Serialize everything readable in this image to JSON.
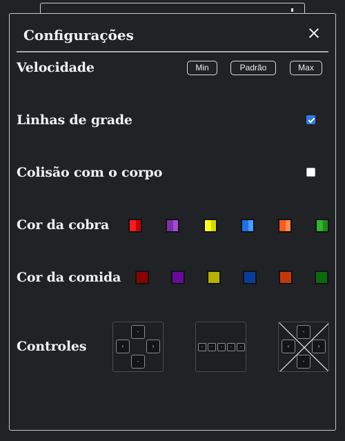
{
  "panel": {
    "title": "Configurações",
    "close_icon": "close-icon"
  },
  "speed": {
    "label": "Velocidade",
    "options": [
      "Min",
      "Padrão",
      "Max"
    ]
  },
  "grid_lines": {
    "label": "Linhas de grade",
    "checked": true
  },
  "body_collision": {
    "label": "Colisão com o corpo",
    "checked": false
  },
  "snake_color": {
    "label": "Cor da cobra",
    "swatches": [
      {
        "name": "red",
        "main": "#ff1a1a",
        "shade": "#c40000"
      },
      {
        "name": "purple",
        "main": "#7d2ea8",
        "shade": "#a24bd6"
      },
      {
        "name": "yellow",
        "main": "#ffff1a",
        "shade": "#d9d900"
      },
      {
        "name": "blue",
        "main": "#1e6fe8",
        "shade": "#4a9bff"
      },
      {
        "name": "orange",
        "main": "#ff5a1a",
        "shade": "#ff8a4a"
      },
      {
        "name": "green",
        "main": "#2fb52f",
        "shade": "#1f8a1f"
      }
    ]
  },
  "food_color": {
    "label": "Cor da comida",
    "swatches": [
      {
        "name": "dark-red",
        "main": "#8b0000"
      },
      {
        "name": "dark-purple",
        "main": "#6a0a9a"
      },
      {
        "name": "olive",
        "main": "#b3b300"
      },
      {
        "name": "dark-blue",
        "main": "#0a3d9a"
      },
      {
        "name": "rust",
        "main": "#c2380a"
      },
      {
        "name": "dark-green",
        "main": "#0b6a0b"
      }
    ]
  },
  "controls": {
    "label": "Controles",
    "options": [
      {
        "name": "dpad",
        "keys": [
          "-",
          "‹",
          "›",
          "-"
        ]
      },
      {
        "name": "row",
        "keys": [
          "-",
          "-",
          "-",
          "-",
          "-"
        ]
      },
      {
        "name": "none",
        "keys": [
          "-",
          "‹",
          "›",
          "-"
        ]
      }
    ]
  }
}
